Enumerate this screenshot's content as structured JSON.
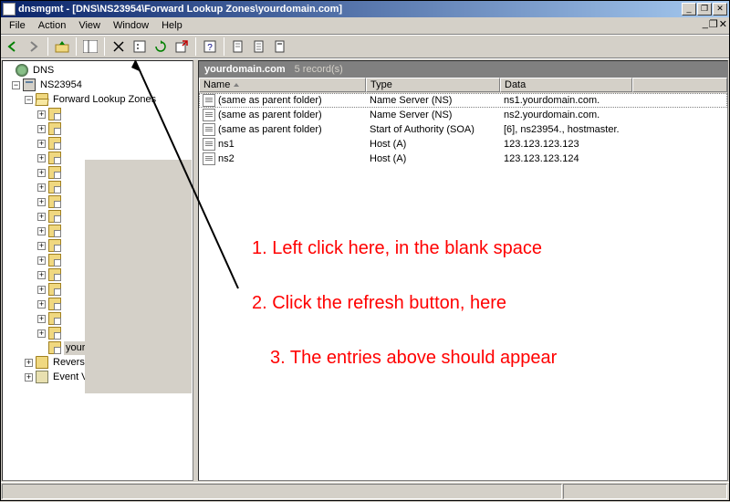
{
  "titlebar": {
    "title": "dnsmgmt - [DNS\\NS23954\\Forward Lookup Zones\\yourdomain.com]",
    "min": "_",
    "max": "❐",
    "close": "✕"
  },
  "menubar": {
    "file": "File",
    "action": "Action",
    "view": "View",
    "window": "Window",
    "help": "Help"
  },
  "tree": {
    "root": "DNS",
    "server": "NS23954",
    "fwd": "Forward Lookup Zones",
    "domain": "yourdomain.com",
    "rev": "Reverse Lookup Zones",
    "event": "Event Viewer"
  },
  "list": {
    "title": "yourdomain.com",
    "subtitle": "5 record(s)",
    "cols": {
      "name": "Name",
      "type": "Type",
      "data": "Data"
    },
    "colw": {
      "name": 183,
      "type": 147,
      "data": 145
    },
    "rows": [
      {
        "name": "(same as parent folder)",
        "type": "Name Server (NS)",
        "data": "ns1.yourdomain.com."
      },
      {
        "name": "(same as parent folder)",
        "type": "Name Server (NS)",
        "data": "ns2.yourdomain.com."
      },
      {
        "name": "(same as parent folder)",
        "type": "Start of Authority (SOA)",
        "data": "[6], ns23954., hostmaster."
      },
      {
        "name": "ns1",
        "type": "Host (A)",
        "data": "123.123.123.123"
      },
      {
        "name": "ns2",
        "type": "Host (A)",
        "data": "123.123.123.124"
      }
    ]
  },
  "annotations": {
    "a1": "1. Left click here, in the blank space",
    "a2": "2. Click the refresh button, here",
    "a3": "3. The entries above should appear"
  }
}
